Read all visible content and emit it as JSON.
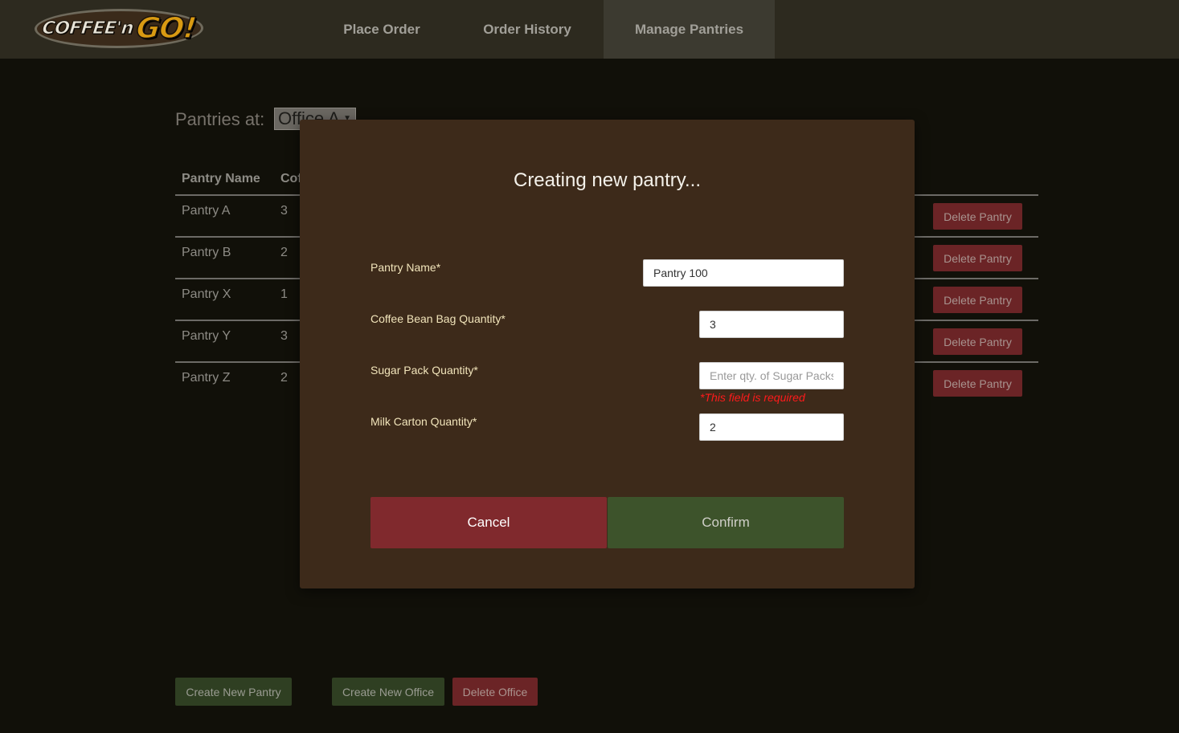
{
  "nav": {
    "logo_text": "COFFEE'n",
    "logo_go": "GO!",
    "items": [
      {
        "label": "Place Order"
      },
      {
        "label": "Order History"
      },
      {
        "label": "Manage Pantries"
      }
    ]
  },
  "page": {
    "office_label": "Pantries at:",
    "office_selected": "Office A",
    "table": {
      "headers": [
        "Pantry Name",
        "Coffee"
      ],
      "rows": [
        {
          "name": "Pantry A",
          "coffee": "3",
          "action": "Delete Pantry"
        },
        {
          "name": "Pantry B",
          "coffee": "2",
          "action": "Delete Pantry"
        },
        {
          "name": "Pantry X",
          "coffee": "1",
          "action": "Delete Pantry"
        },
        {
          "name": "Pantry Y",
          "coffee": "3",
          "action": "Delete Pantry"
        },
        {
          "name": "Pantry Z",
          "coffee": "2",
          "action": "Delete Pantry"
        }
      ]
    },
    "buttons": {
      "create_pantry": "Create New Pantry",
      "create_office": "Create New Office",
      "delete_office": "Delete Office"
    }
  },
  "modal": {
    "title": "Creating new pantry...",
    "fields": {
      "pantry_name": {
        "label": "Pantry Name",
        "required": "*",
        "value": "Pantry 100"
      },
      "coffee_qty": {
        "label": "Coffee Bean Bag Quantity",
        "required": "*",
        "value": "3"
      },
      "sugar_qty": {
        "label": "Sugar Pack Quantity",
        "required": "*",
        "value": "",
        "placeholder": "Enter qty. of Sugar Packs",
        "error": "*This field is required"
      },
      "milk_qty": {
        "label": "Milk Carton Quantity",
        "required": "*",
        "value": "2"
      }
    },
    "cancel_label": "Cancel",
    "confirm_label": "Confirm"
  },
  "colors": {
    "modal_bg": "#3d2a1a",
    "cancel": "#80292d",
    "confirm": "#3d532b",
    "error": "#ff1a1a"
  }
}
